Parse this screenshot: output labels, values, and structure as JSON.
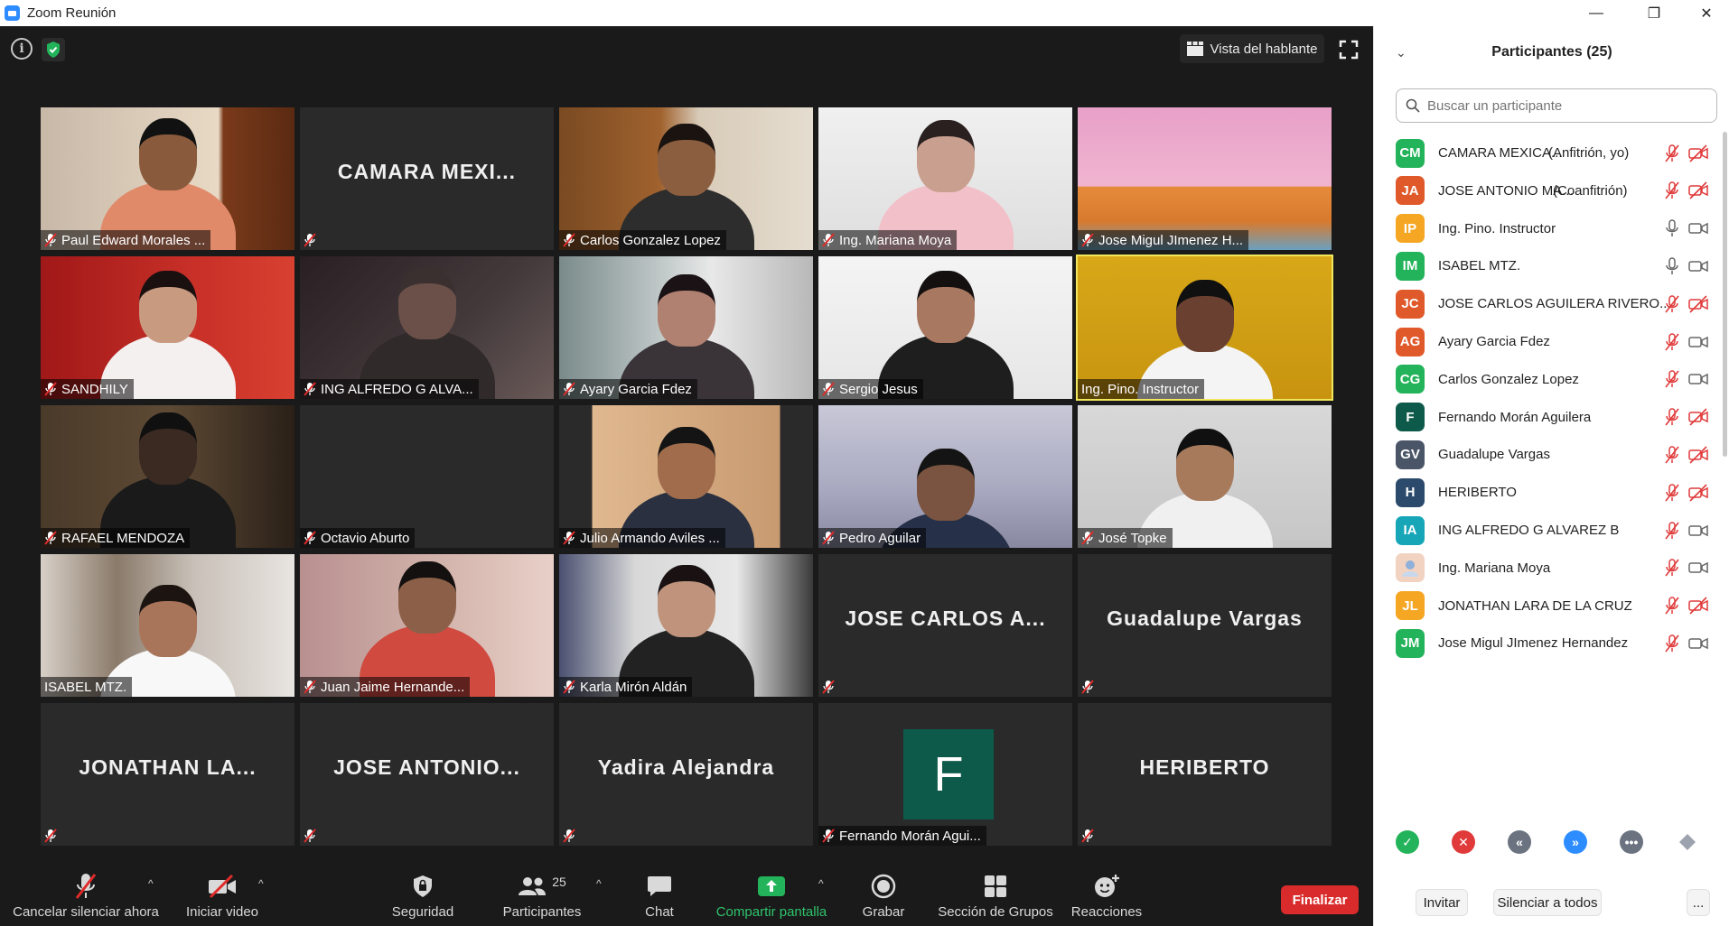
{
  "window": {
    "title": "Zoom Reunión",
    "minimize_glyph": "—",
    "restore_glyph": "❐",
    "close_glyph": "✕"
  },
  "meeting": {
    "speaker_view_label": "Vista del hablante",
    "tiles": [
      {
        "name": "Paul Edward Morales ...",
        "video": true,
        "muted": true,
        "scene": "orange-wall"
      },
      {
        "name": "",
        "big_name": "CAMARA  MEXI...",
        "video": false,
        "muted": true
      },
      {
        "name": "Carlos Gonzalez Lopez",
        "video": true,
        "muted": true,
        "scene": "wood-cabinet"
      },
      {
        "name": "Ing. Mariana Moya",
        "video": true,
        "muted": true,
        "scene": "white-room"
      },
      {
        "name": "Jose Migul JImenez H...",
        "video": true,
        "muted": true,
        "scene": "cartoon-room"
      },
      {
        "name": "SANDHILY",
        "video": true,
        "muted": true,
        "scene": "red-wall"
      },
      {
        "name": "ING ALFREDO G ALVA...",
        "video": true,
        "muted": true,
        "scene": "dark-room"
      },
      {
        "name": "Ayary Garcia Fdez",
        "video": true,
        "muted": true,
        "scene": "window-room"
      },
      {
        "name": "Sergio Jesus",
        "video": true,
        "muted": true,
        "scene": "light-wall"
      },
      {
        "name": "Ing. Pino. Instructor",
        "video": true,
        "muted": false,
        "active": true,
        "scene": "yellow-wall"
      },
      {
        "name": "RAFAEL MENDOZA",
        "video": true,
        "muted": true,
        "scene": "dark-wood"
      },
      {
        "name": "Octavio Aburto",
        "video": false,
        "muted": true
      },
      {
        "name": "Julio Armando Aviles ...",
        "video": true,
        "muted": true,
        "scene": "mask-room"
      },
      {
        "name": "Pedro Aguilar",
        "video": true,
        "muted": true,
        "scene": "office-blue"
      },
      {
        "name": "José Topke",
        "video": true,
        "muted": true,
        "scene": "grey-wall"
      },
      {
        "name": "ISABEL MTZ.",
        "video": true,
        "muted": false,
        "scene": "home-room"
      },
      {
        "name": "Juan Jaime Hernande...",
        "video": true,
        "muted": true,
        "scene": "pink-room"
      },
      {
        "name": "Karla Mirón Aldán",
        "video": true,
        "muted": true,
        "scene": "chair-room"
      },
      {
        "name": "",
        "big_name": "JOSE CARLOS  A...",
        "video": false,
        "muted": true
      },
      {
        "name": "",
        "big_name": "Guadalupe Vargas",
        "video": false,
        "muted": true
      },
      {
        "name": "",
        "big_name": "JONATHAN  LA...",
        "video": false,
        "muted": true
      },
      {
        "name": "",
        "big_name": "JOSE  ANTONIO...",
        "video": false,
        "muted": true
      },
      {
        "name": "",
        "big_name": "Yadira Alejandra",
        "video": false,
        "muted": true
      },
      {
        "name": "Fernando Morán Agui...",
        "avatar_letter": "F",
        "video": false,
        "muted": true
      },
      {
        "name": "",
        "big_name": "HERIBERTO",
        "video": false,
        "muted": true
      }
    ]
  },
  "toolbar": {
    "mute_label": "Cancelar silenciar ahora",
    "video_label": "Iniciar video",
    "security_label": "Seguridad",
    "participants_label": "Participantes",
    "participants_count": "25",
    "chat_label": "Chat",
    "share_label": "Compartir pantalla",
    "record_label": "Grabar",
    "breakout_label": "Sección de Grupos",
    "reactions_label": "Reacciones",
    "end_label": "Finalizar",
    "caret_glyph": "^"
  },
  "panel": {
    "title": "Participantes (25)",
    "collapse_glyph": "⌄",
    "search_placeholder": "Buscar un participante",
    "participants": [
      {
        "initials": "CM",
        "color": "#23b35a",
        "name": "CAMARA MEXICA...",
        "role": "(Anfitrión, yo)",
        "mic": "muted",
        "cam": "off"
      },
      {
        "initials": "JA",
        "color": "#e0592a",
        "name": "JOSE ANTONIO MA...",
        "role": "(Coanfitrión)",
        "mic": "muted",
        "cam": "off"
      },
      {
        "initials": "IP",
        "color": "#f5a623",
        "name": "Ing. Pino. Instructor",
        "role": "",
        "mic": "on",
        "cam": "on"
      },
      {
        "initials": "IM",
        "color": "#23b35a",
        "name": "ISABEL MTZ.",
        "role": "",
        "mic": "on",
        "cam": "on"
      },
      {
        "initials": "JC",
        "color": "#e0592a",
        "name": "JOSE CARLOS AGUILERA RIVERO...",
        "role": "",
        "mic": "muted",
        "cam": "off"
      },
      {
        "initials": "AG",
        "color": "#e0592a",
        "name": "Ayary Garcia Fdez",
        "role": "",
        "mic": "muted",
        "cam": "on"
      },
      {
        "initials": "CG",
        "color": "#23b35a",
        "name": "Carlos Gonzalez Lopez",
        "role": "",
        "mic": "muted",
        "cam": "on"
      },
      {
        "initials": "F",
        "color": "#0e5a4a",
        "name": "Fernando Morán Aguilera",
        "role": "",
        "mic": "muted",
        "cam": "off"
      },
      {
        "initials": "GV",
        "color": "#4a5568",
        "name": "Guadalupe Vargas",
        "role": "",
        "mic": "muted",
        "cam": "off"
      },
      {
        "initials": "H",
        "color": "#2c4a6b",
        "name": "HERIBERTO",
        "role": "",
        "mic": "muted",
        "cam": "off"
      },
      {
        "initials": "IA",
        "color": "#16a6b8",
        "name": "ING ALFREDO G ALVAREZ B",
        "role": "",
        "mic": "muted",
        "cam": "on"
      },
      {
        "initials": "",
        "color": "#f2d3c2",
        "name": "Ing. Mariana Moya",
        "role": "",
        "mic": "muted",
        "cam": "on"
      },
      {
        "initials": "JL",
        "color": "#f5a623",
        "name": "JONATHAN LARA DE LA CRUZ",
        "role": "",
        "mic": "muted",
        "cam": "off"
      },
      {
        "initials": "JM",
        "color": "#23b35a",
        "name": "Jose Migul JImenez Hernandez",
        "role": "",
        "mic": "muted",
        "cam": "on"
      }
    ],
    "reactions": [
      {
        "name": "yes",
        "glyph": "✓",
        "color": "#23b35a"
      },
      {
        "name": "no",
        "glyph": "✕",
        "color": "#e03a3a"
      },
      {
        "name": "slow-down",
        "glyph": "«",
        "color": "#6b7280"
      },
      {
        "name": "speed-up",
        "glyph": "»",
        "color": "#2d8cff"
      },
      {
        "name": "more",
        "glyph": "•••",
        "color": "#6b7280"
      },
      {
        "name": "clear",
        "glyph": "",
        "color": "#9ca3af"
      }
    ],
    "invite_label": "Invitar",
    "mute_all_label": "Silenciar a todos",
    "more_label": "..."
  }
}
